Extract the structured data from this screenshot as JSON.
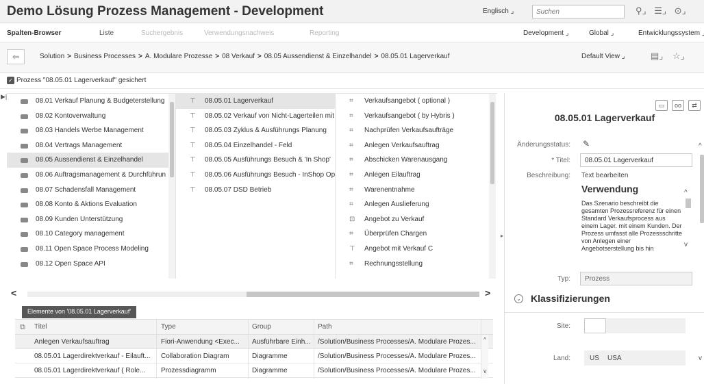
{
  "app": {
    "title": "Demo Lösung Prozess Management - Development",
    "language": "Englisch",
    "search_placeholder": "Suchen",
    "icons": [
      "binoculars-icon",
      "list-icon",
      "help-icon"
    ]
  },
  "nav": {
    "tabs": [
      {
        "label": "Spalten-Browser",
        "state": "active"
      },
      {
        "label": "Liste",
        "state": "normal"
      },
      {
        "label": "Suchergebnis",
        "state": "disabled"
      },
      {
        "label": "Verwendungsnachweis",
        "state": "disabled"
      },
      {
        "label": "Reporting",
        "state": "disabled"
      }
    ],
    "right": [
      "Development",
      "Global",
      "Entwicklungssystem"
    ]
  },
  "breadcrumb": {
    "back_icon": "back-arrow-icon",
    "items": [
      "Solution",
      "Business Processes",
      "A. Modulare Prozesse",
      "08 Verkauf",
      "08.05 Aussendienst & Einzelhandel",
      "08.05.01 Lagerverkauf"
    ],
    "default_view": "Default View"
  },
  "status": {
    "message": "Prozess \"08.05.01 Lagerverkauf\" gesichert"
  },
  "columns": {
    "col1": [
      "08.01 Verkauf Planung & Budgeterstellung",
      "08.02 Kontoverwaltung",
      "08.03 Handels Werbe Management",
      "08.04 Vertrags Management",
      "08.05 Aussendienst & Einzelhandel",
      "08.06 Auftragsmanagement & Durchführun",
      "08.07 Schadensfall Management",
      "08.08 Konto & Aktions Evaluation",
      "08.09 Kunden Unterstützung",
      "08.10 Category management",
      "08.11 Open Space Process Modeling",
      "08.12 Open Space API"
    ],
    "col1_selected": 4,
    "col2": [
      "08.05.01 Lagerverkauf",
      "08.05.02 Verkauf von Nicht-Lagerteilen mit",
      "08.05.03 Zyklus & Ausführungs Planung",
      "08.05.04 Einzelhandel - Feld",
      "08.05.05 Ausführungs Besuch & 'In Shop'",
      "08.05.06 Ausführungs Besuch - InShop Op",
      "08.05.07 DSD Betrieb"
    ],
    "col2_selected": 0,
    "col3": [
      "Verkaufsangebot ( optional )",
      "Verkaufsangebot ( by Hybris )",
      "Nachprüfen Verkaufsaufträge",
      "Anlegen Verkaufsauftrag",
      "Abschicken Warenausgang",
      "Anlegen Eilauftrag",
      "Warenentnahme",
      "Anlegen Auslieferung",
      "Angebot zu Verkauf",
      "Überprüfen Chargen",
      "Angebot mit Verkauf C",
      "Rechnungsstellung"
    ],
    "col3_icons": [
      "step",
      "step",
      "step",
      "step",
      "step",
      "step",
      "step",
      "step",
      "trans",
      "step",
      "proc",
      "step"
    ]
  },
  "elements": {
    "tab_label": "Elemente von '08.05.01 Lagerverkauf'",
    "headers": [
      "Titel",
      "Type",
      "Group",
      "Path"
    ],
    "rows": [
      [
        "Anlegen Verkaufsauftrag",
        "Fiori-Anwendung <Exec...",
        "Ausführbare Einh...",
        "/Solution/Business Processes/A. Modulare Prozes..."
      ],
      [
        "08.05.01 Lagerdirektverkauf - Eilauft...",
        "Collaboration Diagram",
        "Diagramme",
        "/Solution/Business Processes/A. Modulare Prozes..."
      ],
      [
        "08.05.01 Lagerdirektverkauf ( Role...",
        "Prozessdiagramm",
        "Diagramme",
        "/Solution/Business Processes/A. Modulare Prozes..."
      ]
    ]
  },
  "details": {
    "title": "08.05.01 Lagerverkauf",
    "labels": {
      "status": "Änderungsstatus:",
      "titel": "* Titel:",
      "beschreibung": "Beschreibung:",
      "typ": "Typ:",
      "site": "Site:",
      "land": "Land:"
    },
    "titel_value": "08.05.01 Lagerverkauf",
    "edit_text": "Text bearbeiten",
    "desc_heading": "Verwendung",
    "desc_body": "Das Szenario beschreibt die gesamten Prozessreferenz für einen Standard Verkaufsprocess aus einem Lager. mit einem Kunden. Der Prozess umfasst alle Prozessschritte von Anlegen einer Angebotserstellung bis hin",
    "typ_value": "Prozess",
    "section": "Klassifizierungen",
    "site_value": "",
    "land_code": "US",
    "land_name": "USA"
  }
}
